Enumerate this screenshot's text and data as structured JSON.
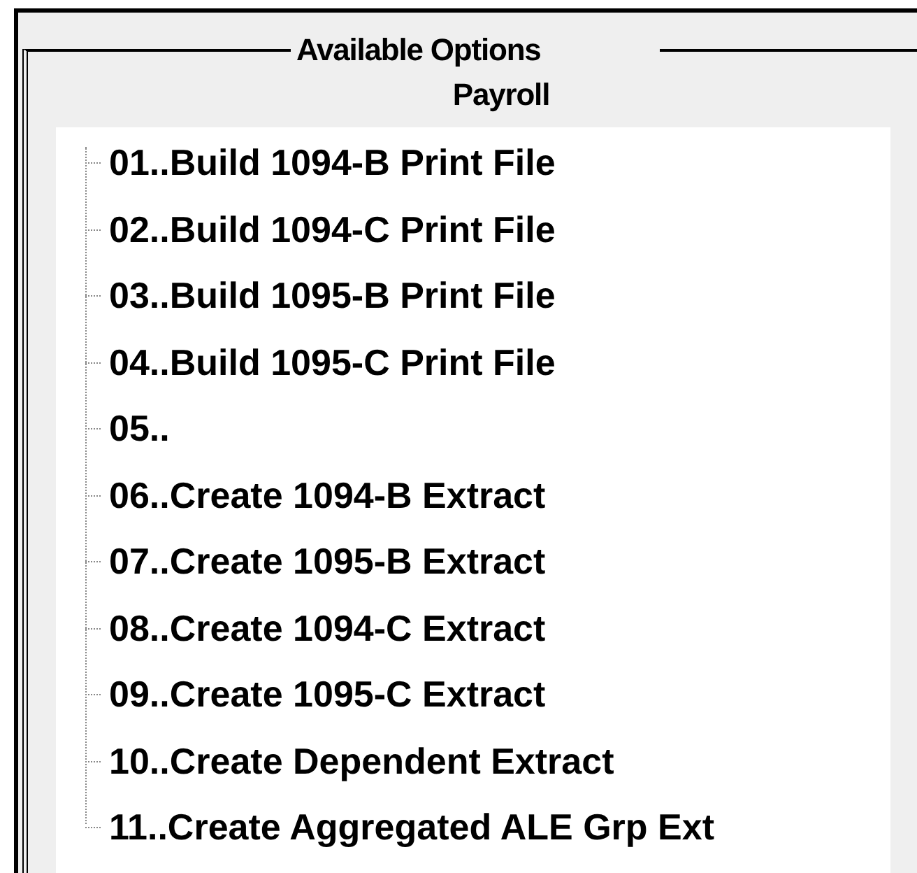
{
  "group": {
    "title": "Available Options"
  },
  "tree": {
    "root": "Payroll",
    "items": [
      {
        "label": "01..Build 1094-B Print File"
      },
      {
        "label": "02..Build 1094-C Print File"
      },
      {
        "label": "03..Build 1095-B Print File"
      },
      {
        "label": "04..Build 1095-C Print File"
      },
      {
        "label": "05.."
      },
      {
        "label": "06..Create 1094-B Extract"
      },
      {
        "label": "07..Create 1095-B Extract"
      },
      {
        "label": "08..Create 1094-C Extract"
      },
      {
        "label": "09..Create 1095-C Extract"
      },
      {
        "label": "10..Create Dependent Extract"
      },
      {
        "label": "11..Create Aggregated ALE Grp Ext"
      }
    ]
  }
}
